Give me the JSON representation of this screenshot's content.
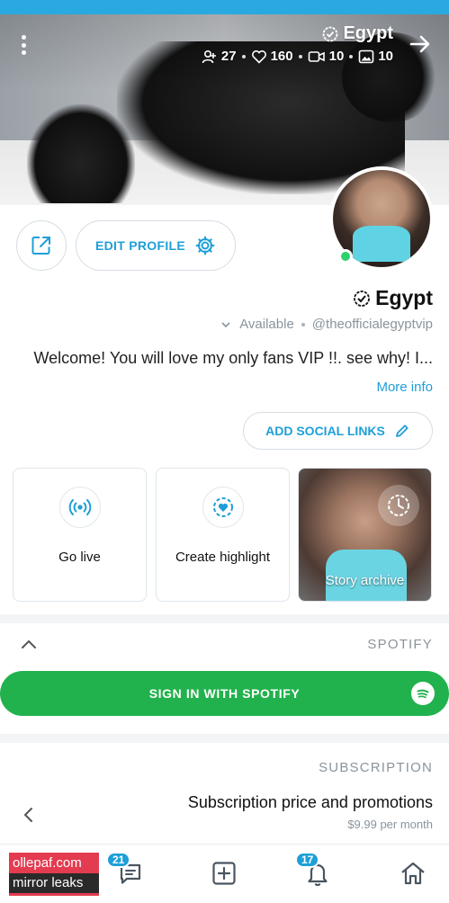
{
  "cover": {
    "name": "Egypt",
    "stats": {
      "photos": "10",
      "videos": "10",
      "likes": "160",
      "fans": "27"
    }
  },
  "profile": {
    "name": "Egypt",
    "handle": "@theofficialegyptvip",
    "status": "Available",
    "bio": "Welcome! You will love my only fans VIP !!. see why! I...",
    "more_info": "More info"
  },
  "buttons": {
    "edit_profile": "EDIT PROFILE",
    "add_social_links": "ADD SOCIAL LINKS",
    "sign_in_spotify": "SIGN IN WITH SPOTIFY"
  },
  "cards": {
    "story_archive": "Story archive",
    "create_highlight": "Create highlight",
    "go_live": "Go live"
  },
  "sections": {
    "spotify": "SPOTIFY",
    "subscription": "SUBSCRIPTION"
  },
  "subscription": {
    "title": "Subscription price and promotions",
    "price": "$9.99 per month"
  },
  "nav": {
    "notifications_badge": "17",
    "messages_badge": "21"
  },
  "watermark": {
    "line1": "ollepaf.com",
    "line2": "mirror leaks"
  },
  "colors": {
    "accent": "#1e9fd8",
    "spotify_green": "#22b24d",
    "online": "#2ed06e"
  }
}
